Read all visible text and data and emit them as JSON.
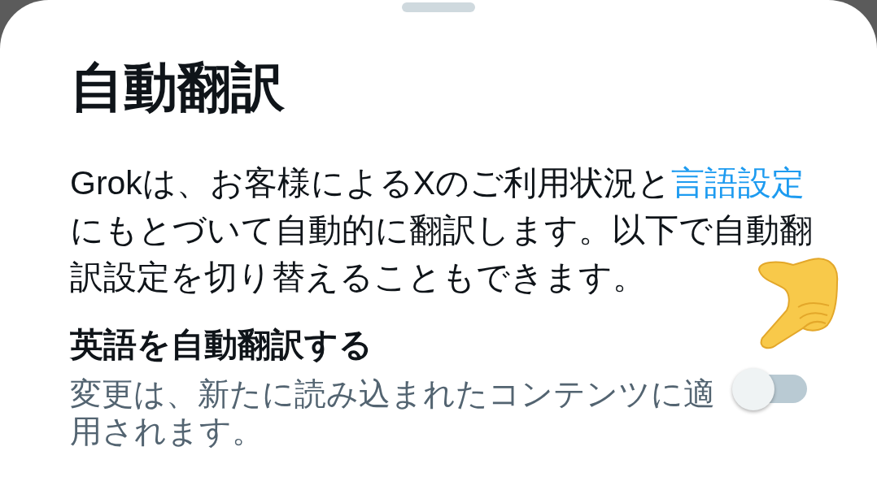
{
  "sheet": {
    "title": "自動翻訳",
    "description": [
      {
        "kind": "text",
        "text": "Grokは、お客様によるXのご利用状況と"
      },
      {
        "kind": "link",
        "text": "言語設定"
      },
      {
        "kind": "text",
        "text": "にもとづいて自動的に翻訳します。以下で自動翻訳設定を切り替えることもできます。"
      }
    ]
  },
  "setting": {
    "label": "英語を自動翻訳する",
    "description": "変更は、新たに読み込まれたコンテンツに適用されます。",
    "on": false
  }
}
